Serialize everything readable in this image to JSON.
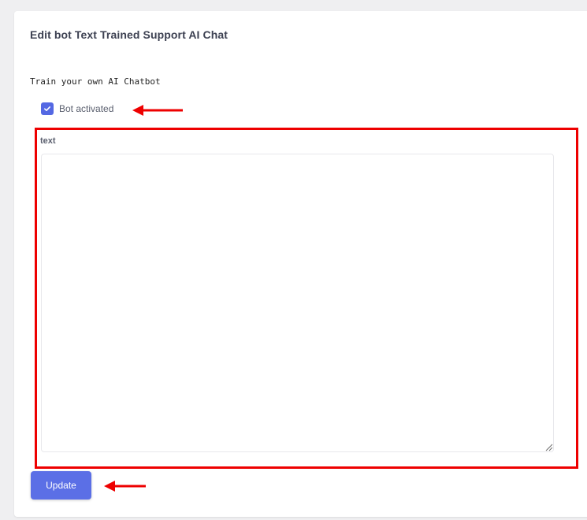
{
  "page": {
    "title": "Edit bot Text Trained Support AI Chat",
    "subtitle": "Train your own AI Chatbot"
  },
  "bot_activated": {
    "label": "Bot activated",
    "checked": true
  },
  "text_field": {
    "label": "text",
    "value": ""
  },
  "update_button": {
    "label": "Update"
  },
  "colors": {
    "accent": "#5b6fe6",
    "annotation": "#ee0000",
    "background": "#efeff1"
  },
  "icons": {
    "checkbox": "check-icon",
    "annotation_arrow": "arrow-left-icon",
    "resize": "resize-handle-icon"
  }
}
